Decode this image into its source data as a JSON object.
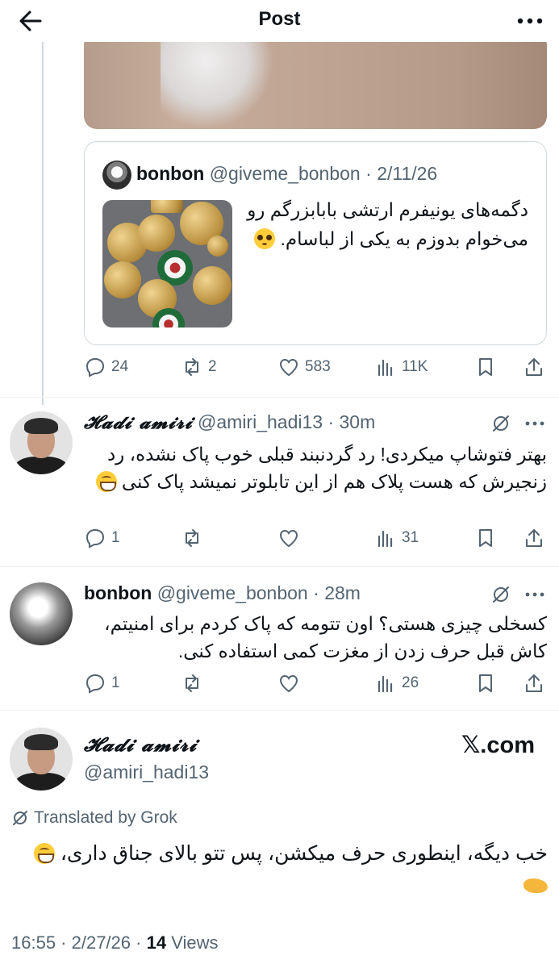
{
  "header": {
    "title": "Post"
  },
  "quote": {
    "name": "bonbon",
    "handle": "@giveme_bonbon",
    "date": "2/11/26",
    "text": "دگمه‌های یونیفرم ارتشی بابابزرگم رو می‌خوام بدوزم به یکی از لباسام."
  },
  "quote_actions": {
    "replies": "24",
    "reposts": "2",
    "likes": "583",
    "views": "11K"
  },
  "reply1": {
    "name": "𝓗𝓪𝓭𝓲 𝓪𝓶𝓲𝓻𝓲",
    "handle": "@amiri_hadi13",
    "time": "30m",
    "text": "بهتر فتوشاپ میکردی! رد گردنبند قبلی خوب پاک نشده، رد زنجیرش که هست پلاک هم از این تابلوتر نمیشد پاک کنی",
    "actions": {
      "replies": "1",
      "views": "31"
    }
  },
  "reply2": {
    "name": "bonbon",
    "handle": "@giveme_bonbon",
    "time": "28m",
    "text": "کسخلی چیزی هستی؟ اون تتومه که پاک کردم برای امنیتم، کاش قبل حرف زدن از مغزت کمی استفاده کنی.",
    "actions": {
      "replies": "1",
      "views": "26"
    }
  },
  "main": {
    "name": "𝓗𝓪𝓭𝓲 𝓪𝓶𝓲𝓻𝓲",
    "handle": "@amiri_hadi13",
    "brand": "𝕏.com",
    "translated": "Translated by Grok",
    "text": "خب دیگه، اینطوری حرف میکشن، پس تتو بالای جناق داری،",
    "time": "16:55 · 2/27/26 ·",
    "views_count": "14",
    "views_label": "Views"
  }
}
